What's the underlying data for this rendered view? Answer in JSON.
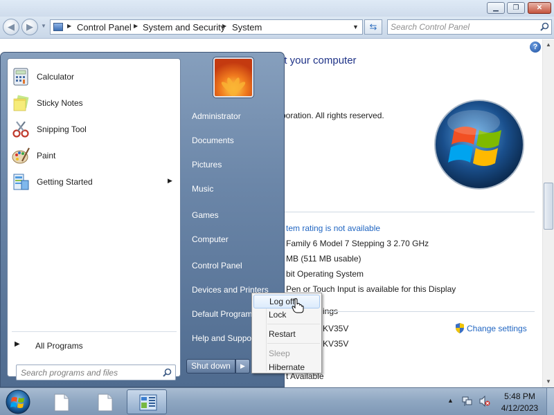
{
  "control_panel": {
    "breadcrumb": [
      "Control Panel",
      "System and Security",
      "System"
    ],
    "search_placeholder": "Search Control Panel",
    "heading_partial": "ut your computer",
    "copyright_partial": "rporation.  All rights reserved.",
    "rating_partial": "tem rating is not available",
    "processor_partial": "Family 6 Model 7 Stepping 3   2.70 GHz",
    "memory_partial": "MB (511 MB usable)",
    "system_type_partial": "bit Operating System",
    "pen_touch_partial": "Pen or Touch Input is available for this Display",
    "settings_header_partial": "ings",
    "computer_name_partial": "KV35V",
    "full_name_partial": "KV35V",
    "activation_partial": "t Available",
    "change_settings": "Change settings"
  },
  "start_menu": {
    "pinned": [
      {
        "label": "Calculator",
        "icon": "calculator-icon"
      },
      {
        "label": "Sticky Notes",
        "icon": "sticky-notes-icon"
      },
      {
        "label": "Snipping Tool",
        "icon": "snipping-tool-icon"
      },
      {
        "label": "Paint",
        "icon": "paint-icon"
      },
      {
        "label": "Getting Started",
        "icon": "getting-started-icon"
      }
    ],
    "all_programs": "All Programs",
    "search_placeholder": "Search programs and files",
    "right_items": [
      "Administrator",
      "Documents",
      "Pictures",
      "Music",
      "Games",
      "Computer",
      "Control Panel",
      "Devices and Printers",
      "Default Programs",
      "Help and Support"
    ],
    "shutdown_label": "Shut down"
  },
  "power_menu": {
    "items": [
      {
        "label": "Log off",
        "state": "highlighted"
      },
      {
        "label": "Lock",
        "state": "normal"
      },
      {
        "label": "Restart",
        "state": "normal"
      },
      {
        "label": "Sleep",
        "state": "disabled"
      },
      {
        "label": "Hibernate",
        "state": "normal"
      }
    ]
  },
  "taskbar": {
    "buttons": [
      "document-icon",
      "document-icon",
      "control-panel-icon"
    ],
    "time": "5:48 PM",
    "date": "4/12/2023"
  },
  "colors": {
    "link": "#2166c2",
    "heading": "#1e3287",
    "start_menu_right": "#6b86a8",
    "taskbar": "#8ea6c1"
  }
}
